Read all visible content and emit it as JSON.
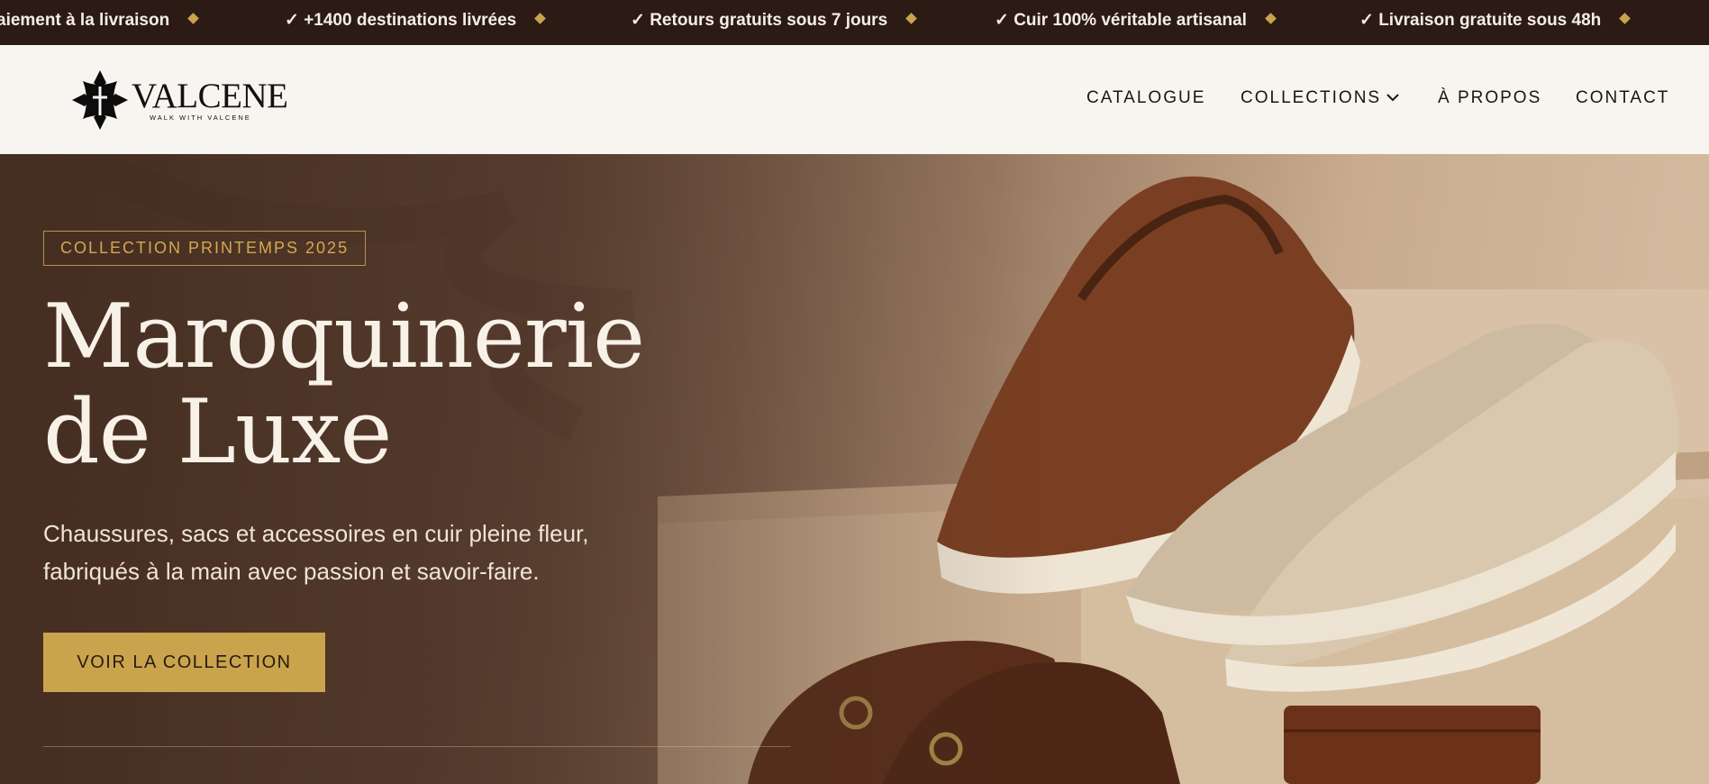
{
  "ticker": {
    "items": [
      "aiement à la livraison",
      "✓ +1400 destinations livrées",
      "✓ Retours gratuits sous 7 jours",
      "✓ Cuir 100% véritable artisanal",
      "✓ Livraison gratuite sous 48h"
    ],
    "separator_color": "#c9a24c"
  },
  "header": {
    "logo": {
      "wordmark": "VALCENE",
      "tagline": "WALK WITH VALCENE"
    },
    "nav": {
      "catalogue": "CATALOGUE",
      "collections": "COLLECTIONS",
      "apropos": "À PROPOS",
      "contact": "CONTACT"
    }
  },
  "hero": {
    "badge": "COLLECTION PRINTEMPS 2025",
    "title_line1": "Maroquinerie",
    "title_line2": "de Luxe",
    "subtitle_line1": "Chaussures, sacs et accessoires en cuir pleine fleur,",
    "subtitle_line2": "fabriqués à la main avec passion et savoir-faire.",
    "cta": "VOIR LA COLLECTION"
  },
  "colors": {
    "topbar": "#2c1a14",
    "accent_gold": "#c9a44c",
    "header_bg": "#f8f5f0",
    "hero_text": "#f8f1e7"
  }
}
